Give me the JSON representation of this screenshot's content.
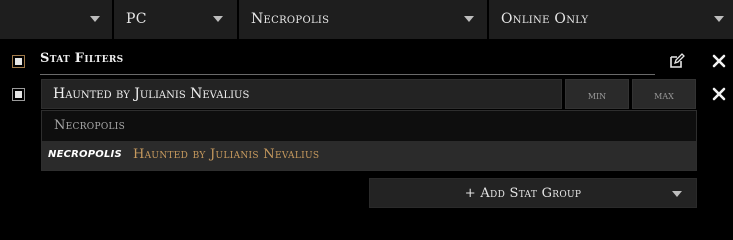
{
  "top_filters": {
    "category": {
      "value": ""
    },
    "platform": {
      "value": "PC"
    },
    "league": {
      "value": "Necropolis"
    },
    "status": {
      "value": "Online Only"
    }
  },
  "stat_filters": {
    "title": "Stat Filters",
    "group_checked": true,
    "row_checked": true,
    "search_value": "Haunted by Julianis Nevalius",
    "min_placeholder": "min",
    "max_placeholder": "max"
  },
  "suggestions": {
    "group_label": "Necropolis",
    "items": [
      {
        "tag": "NECROPOLIS",
        "text": "Haunted by Julianis Nevalius"
      }
    ]
  },
  "add_stat_group": {
    "label": "+ Add Stat Group"
  },
  "colors": {
    "background": "#000000",
    "panel": "#1e1e1e",
    "highlight_text": "#c79a5e",
    "checkbox_border_brown": "#a07a4a"
  },
  "icons": {
    "edit": "edit-icon",
    "remove_group": "close-icon",
    "remove_row": "close-icon",
    "dropdown": "chevron-down-icon"
  }
}
